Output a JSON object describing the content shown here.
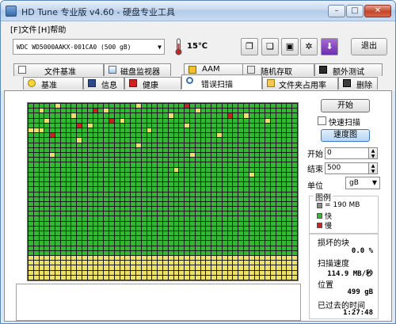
{
  "window": {
    "title": "HD Tune 专业版 v4.60 - 硬盘专业工具",
    "controls": {
      "minimize": "–",
      "maximize": "□",
      "close": "✕"
    }
  },
  "menu": {
    "file": "[F]文件",
    "help": "[H]帮助"
  },
  "toolbar": {
    "drive": "WDC WD5000AAKX-001CA0 (500 gB)",
    "temperature": "15℃",
    "exit_label": "退出",
    "buttons": [
      "copy-info",
      "copy-screenshot",
      "save",
      "options",
      "download"
    ]
  },
  "tabs": {
    "row1": [
      "文件基准",
      "磁盘监视器",
      "AAM",
      "随机存取",
      "额外测试"
    ],
    "row2": [
      "基准",
      "信息",
      "健康",
      "错误扫描",
      "文件夹占用率",
      "删除"
    ],
    "active": "错误扫描"
  },
  "scan": {
    "start_button": "开始",
    "quick_scan_label": "快速扫描",
    "quick_scan_checked": false,
    "map_button": "速度图",
    "start_label": "开始",
    "start_value": "0",
    "end_label": "结束",
    "end_value": "500",
    "unit_label": "单位",
    "unit_value": "gB"
  },
  "legend": {
    "title": "图例",
    "items": [
      {
        "label": "= 190 MB",
        "color": "#8a8a8a"
      },
      {
        "label": "快",
        "color": "#33b833"
      },
      {
        "label": "慢",
        "color": "#c62424"
      }
    ]
  },
  "stats": {
    "damaged_label": "损坏的块",
    "damaged_value": "0.0 %",
    "speed_label": "扫描速度",
    "speed_value": "114.9 MB/秒",
    "position_label": "位置",
    "position_value": "499 gB",
    "elapsed_label": "已过去的时间",
    "elapsed_value": "1:27:48"
  },
  "block_map": {
    "columns": 50,
    "rows": 36,
    "yellow_cells": [
      [
        0,
        5
      ],
      [
        0,
        20
      ],
      [
        1,
        2
      ],
      [
        1,
        14
      ],
      [
        1,
        31
      ],
      [
        2,
        8
      ],
      [
        2,
        26
      ],
      [
        2,
        40
      ],
      [
        3,
        3
      ],
      [
        3,
        17
      ],
      [
        3,
        44
      ],
      [
        4,
        11
      ],
      [
        4,
        29
      ],
      [
        5,
        0
      ],
      [
        5,
        1
      ],
      [
        5,
        2
      ],
      [
        5,
        22
      ],
      [
        6,
        35
      ],
      [
        7,
        9
      ],
      [
        8,
        20
      ],
      [
        10,
        4
      ],
      [
        10,
        30
      ],
      [
        13,
        27
      ],
      [
        14,
        41
      ]
    ],
    "red_cells": [
      [
        0,
        29
      ],
      [
        1,
        12
      ],
      [
        3,
        15
      ],
      [
        4,
        9
      ],
      [
        2,
        37
      ],
      [
        6,
        4
      ]
    ],
    "yellow_rows_from": 31
  }
}
